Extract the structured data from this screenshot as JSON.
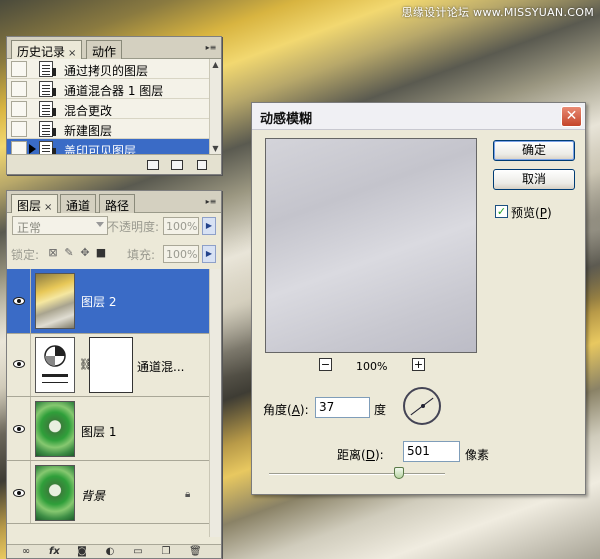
{
  "watermark": "思缘设计论坛 www.MISSYUAN.COM",
  "history_panel": {
    "tabs": [
      {
        "label": "历史记录",
        "close": "×"
      },
      {
        "label": "动作"
      }
    ],
    "menu_icon": "panel-menu-icon",
    "rows": [
      {
        "label": "通过拷贝的图层"
      },
      {
        "label": "通道混合器 1 图层"
      },
      {
        "label": "混合更改"
      },
      {
        "label": "新建图层"
      },
      {
        "label": "盖印可见图层",
        "selected": true
      }
    ]
  },
  "layers_panel": {
    "tabs": [
      {
        "label": "图层",
        "close": "×"
      },
      {
        "label": "通道"
      },
      {
        "label": "路径"
      }
    ],
    "blend_mode": "正常",
    "opacity_label": "不透明度:",
    "opacity_value": "100%",
    "lock_label": "锁定:",
    "fill_label": "填充:",
    "fill_value": "100%",
    "layers": [
      {
        "name": "图层 2",
        "visible": true,
        "selected": true,
        "thumb": "motion-blur"
      },
      {
        "name": "通道混...",
        "visible": true,
        "thumb": "channel-mixer-adjustment",
        "mask": true
      },
      {
        "name": "图层 1",
        "visible": true,
        "thumb": "photo"
      },
      {
        "name": "背景",
        "visible": true,
        "thumb": "photo",
        "locked": true
      }
    ],
    "toolbar_icons": [
      "link-icon",
      "fx-icon",
      "mask-icon",
      "adjustment-icon",
      "group-icon",
      "new-layer-icon",
      "trash-icon"
    ]
  },
  "dialog": {
    "title": "动感模糊",
    "close": "✕",
    "ok_label": "确定",
    "cancel_label": "取消",
    "preview_label": "预览(",
    "preview_key": "P",
    "preview_label_end": ")",
    "preview_checked": true,
    "zoom_out": "−",
    "zoom_in": "+",
    "zoom_level": "100%",
    "angle_label": "角度(",
    "angle_key": "A",
    "angle_label_end": "):",
    "angle_value": "37",
    "angle_unit": "度",
    "distance_label": "距离(",
    "distance_key": "D",
    "distance_label_end": "):",
    "distance_value": "501",
    "distance_unit": "像素",
    "distance_slider": {
      "value": 501,
      "min": 1,
      "max": 999
    }
  }
}
